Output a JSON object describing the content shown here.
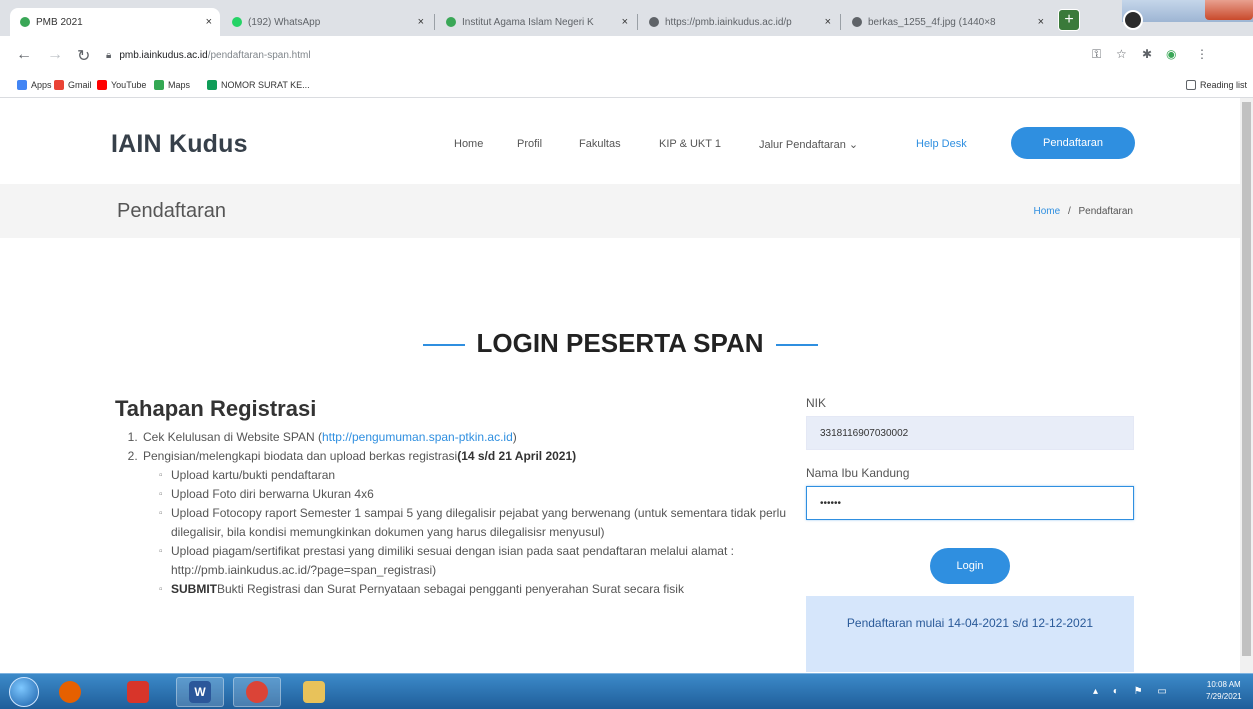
{
  "browser": {
    "tabs": [
      {
        "title": "PMB 2021",
        "close": "×",
        "favicon_color": "#3aa757"
      },
      {
        "title": "(192) WhatsApp",
        "close": "×",
        "favicon_color": "#25d366"
      },
      {
        "title": "Institut Agama Islam Negeri K",
        "close": "×",
        "favicon_color": "#3aa757"
      },
      {
        "title": "https://pmb.iainkudus.ac.id/p",
        "close": "×",
        "favicon_color": "#5f6368"
      },
      {
        "title": "berkas_1255_4f.jpg (1440×8",
        "close": "×",
        "favicon_color": "#5f6368"
      }
    ],
    "new_tab": "+",
    "url_host": "pmb.iainkudus.ac.id",
    "url_path": "/pendaftaran-span.html",
    "bookmarks": [
      {
        "label": "Apps",
        "color": "#4285f4"
      },
      {
        "label": "Gmail",
        "color": "#ea4335"
      },
      {
        "label": "YouTube",
        "color": "#ff0000"
      },
      {
        "label": "Maps",
        "color": "#34a853"
      },
      {
        "label": "NOMOR SURAT KE...",
        "color": "#0f9d58"
      }
    ],
    "reading_list": "Reading list"
  },
  "site": {
    "logo": "IAIN Kudus",
    "nav": [
      "Home",
      "Profil",
      "Fakultas",
      "KIP & UKT 1",
      "Jalur Pendaftaran ⌄",
      "Help Desk"
    ],
    "register_button": "Pendaftaran",
    "page_title": "Pendaftaran",
    "breadcrumb": {
      "home": "Home",
      "separator": "/",
      "current": "Pendaftaran"
    }
  },
  "section_title": "LOGIN PESERTA SPAN",
  "steps": {
    "heading": "Tahapan Registrasi",
    "item1_text": "Cek Kelulusan di Website SPAN (",
    "item1_link": "http://pengumuman.span-ptkin.ac.id",
    "item1_end": ")",
    "item2_text": "Pengisian/melengkapi biodata dan upload berkas registrasi",
    "item2_bold": "(14 s/d 21 April 2021)",
    "sub": [
      "Upload kartu/bukti pendaftaran",
      "Upload Foto diri berwarna Ukuran 4x6",
      "Upload Fotocopy raport Semester 1 sampai 5 yang dilegalisir pejabat yang berwenang (untuk sementara tidak perlu dilegalisir, bila kondisi memungkinkan dokumen yang harus dilegalisisr menyusul)",
      "Upload piagam/sertifikat prestasi yang dimiliki sesuai dengan isian pada saat pendaftaran melalui alamat : http://pmb.iainkudus.ac.id/?page=span_registrasi)"
    ],
    "submit_bold": "SUBMIT",
    "submit_text": "Bukti Registrasi dan Surat Pernyataan sebagai pengganti penyerahan Surat secara fisik"
  },
  "login": {
    "nik_label": "NIK",
    "nik_value": "3318116907030002",
    "mother_label": "Nama Ibu Kandung",
    "mother_value": "••••••",
    "button": "Login",
    "notice": "Pendaftaran mulai 14-04-2021 s/d 12-12-2021"
  },
  "taskbar": {
    "apps": [
      {
        "name": "firefox",
        "glyph": "",
        "color": "#e66000"
      },
      {
        "name": "app-red",
        "glyph": "",
        "color": "#d8352a"
      },
      {
        "name": "word",
        "glyph": "W",
        "color": "#2b579a"
      },
      {
        "name": "chrome",
        "glyph": "",
        "color": "#db4437"
      },
      {
        "name": "explorer",
        "glyph": "",
        "color": "#e8c25a"
      }
    ],
    "tray": "▴ ◐ ⚑ ▭",
    "time": "10:08 AM",
    "date": "7/29/2021"
  },
  "colors": {
    "accent": "#2f8fe0",
    "notice_bg": "#d6e6fb",
    "banner_bg": "#f4f4f4"
  }
}
